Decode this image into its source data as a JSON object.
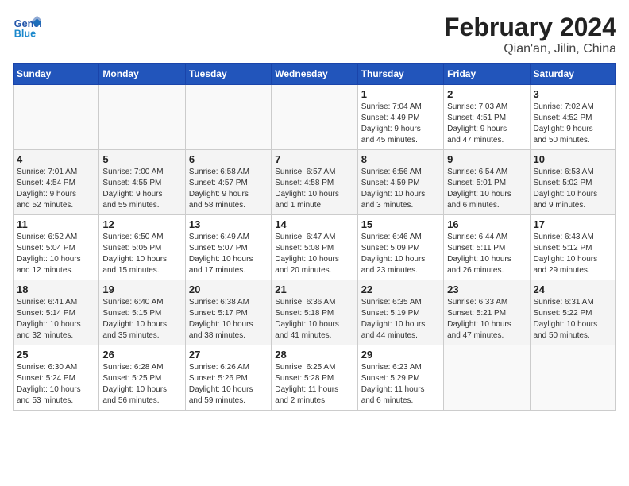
{
  "header": {
    "logo_text_general": "General",
    "logo_text_blue": "Blue",
    "title": "February 2024",
    "subtitle": "Qian'an, Jilin, China"
  },
  "calendar": {
    "days_of_week": [
      "Sunday",
      "Monday",
      "Tuesday",
      "Wednesday",
      "Thursday",
      "Friday",
      "Saturday"
    ],
    "weeks": [
      [
        {
          "day": "",
          "info": ""
        },
        {
          "day": "",
          "info": ""
        },
        {
          "day": "",
          "info": ""
        },
        {
          "day": "",
          "info": ""
        },
        {
          "day": "1",
          "info": "Sunrise: 7:04 AM\nSunset: 4:49 PM\nDaylight: 9 hours\nand 45 minutes."
        },
        {
          "day": "2",
          "info": "Sunrise: 7:03 AM\nSunset: 4:51 PM\nDaylight: 9 hours\nand 47 minutes."
        },
        {
          "day": "3",
          "info": "Sunrise: 7:02 AM\nSunset: 4:52 PM\nDaylight: 9 hours\nand 50 minutes."
        }
      ],
      [
        {
          "day": "4",
          "info": "Sunrise: 7:01 AM\nSunset: 4:54 PM\nDaylight: 9 hours\nand 52 minutes."
        },
        {
          "day": "5",
          "info": "Sunrise: 7:00 AM\nSunset: 4:55 PM\nDaylight: 9 hours\nand 55 minutes."
        },
        {
          "day": "6",
          "info": "Sunrise: 6:58 AM\nSunset: 4:57 PM\nDaylight: 9 hours\nand 58 minutes."
        },
        {
          "day": "7",
          "info": "Sunrise: 6:57 AM\nSunset: 4:58 PM\nDaylight: 10 hours\nand 1 minute."
        },
        {
          "day": "8",
          "info": "Sunrise: 6:56 AM\nSunset: 4:59 PM\nDaylight: 10 hours\nand 3 minutes."
        },
        {
          "day": "9",
          "info": "Sunrise: 6:54 AM\nSunset: 5:01 PM\nDaylight: 10 hours\nand 6 minutes."
        },
        {
          "day": "10",
          "info": "Sunrise: 6:53 AM\nSunset: 5:02 PM\nDaylight: 10 hours\nand 9 minutes."
        }
      ],
      [
        {
          "day": "11",
          "info": "Sunrise: 6:52 AM\nSunset: 5:04 PM\nDaylight: 10 hours\nand 12 minutes."
        },
        {
          "day": "12",
          "info": "Sunrise: 6:50 AM\nSunset: 5:05 PM\nDaylight: 10 hours\nand 15 minutes."
        },
        {
          "day": "13",
          "info": "Sunrise: 6:49 AM\nSunset: 5:07 PM\nDaylight: 10 hours\nand 17 minutes."
        },
        {
          "day": "14",
          "info": "Sunrise: 6:47 AM\nSunset: 5:08 PM\nDaylight: 10 hours\nand 20 minutes."
        },
        {
          "day": "15",
          "info": "Sunrise: 6:46 AM\nSunset: 5:09 PM\nDaylight: 10 hours\nand 23 minutes."
        },
        {
          "day": "16",
          "info": "Sunrise: 6:44 AM\nSunset: 5:11 PM\nDaylight: 10 hours\nand 26 minutes."
        },
        {
          "day": "17",
          "info": "Sunrise: 6:43 AM\nSunset: 5:12 PM\nDaylight: 10 hours\nand 29 minutes."
        }
      ],
      [
        {
          "day": "18",
          "info": "Sunrise: 6:41 AM\nSunset: 5:14 PM\nDaylight: 10 hours\nand 32 minutes."
        },
        {
          "day": "19",
          "info": "Sunrise: 6:40 AM\nSunset: 5:15 PM\nDaylight: 10 hours\nand 35 minutes."
        },
        {
          "day": "20",
          "info": "Sunrise: 6:38 AM\nSunset: 5:17 PM\nDaylight: 10 hours\nand 38 minutes."
        },
        {
          "day": "21",
          "info": "Sunrise: 6:36 AM\nSunset: 5:18 PM\nDaylight: 10 hours\nand 41 minutes."
        },
        {
          "day": "22",
          "info": "Sunrise: 6:35 AM\nSunset: 5:19 PM\nDaylight: 10 hours\nand 44 minutes."
        },
        {
          "day": "23",
          "info": "Sunrise: 6:33 AM\nSunset: 5:21 PM\nDaylight: 10 hours\nand 47 minutes."
        },
        {
          "day": "24",
          "info": "Sunrise: 6:31 AM\nSunset: 5:22 PM\nDaylight: 10 hours\nand 50 minutes."
        }
      ],
      [
        {
          "day": "25",
          "info": "Sunrise: 6:30 AM\nSunset: 5:24 PM\nDaylight: 10 hours\nand 53 minutes."
        },
        {
          "day": "26",
          "info": "Sunrise: 6:28 AM\nSunset: 5:25 PM\nDaylight: 10 hours\nand 56 minutes."
        },
        {
          "day": "27",
          "info": "Sunrise: 6:26 AM\nSunset: 5:26 PM\nDaylight: 10 hours\nand 59 minutes."
        },
        {
          "day": "28",
          "info": "Sunrise: 6:25 AM\nSunset: 5:28 PM\nDaylight: 11 hours\nand 2 minutes."
        },
        {
          "day": "29",
          "info": "Sunrise: 6:23 AM\nSunset: 5:29 PM\nDaylight: 11 hours\nand 6 minutes."
        },
        {
          "day": "",
          "info": ""
        },
        {
          "day": "",
          "info": ""
        }
      ]
    ]
  }
}
